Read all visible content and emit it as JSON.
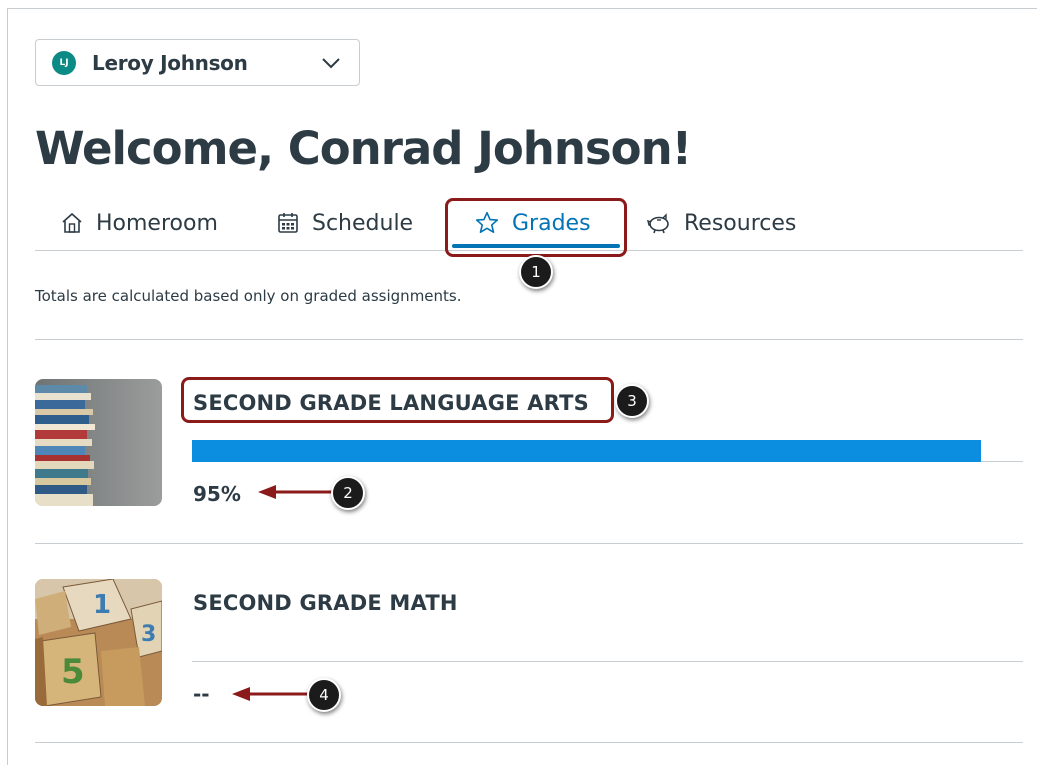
{
  "student_selector": {
    "initials": "LJ",
    "name": "Leroy Johnson"
  },
  "welcome_title": "Welcome, Conrad Johnson!",
  "tabs": [
    {
      "label": "Homeroom",
      "icon": "home-icon"
    },
    {
      "label": "Schedule",
      "icon": "calendar-icon"
    },
    {
      "label": "Grades",
      "icon": "star-icon",
      "active": true
    },
    {
      "label": "Resources",
      "icon": "piggy-bank-icon"
    }
  ],
  "note": "Totals are calculated based only on graded assignments.",
  "courses": [
    {
      "title": "SECOND GRADE LANGUAGE ARTS",
      "grade": "95%",
      "progress": 0.95,
      "image": "books-image"
    },
    {
      "title": "SECOND GRADE MATH",
      "grade": "--",
      "progress": 0,
      "image": "blocks-image"
    }
  ],
  "callouts": [
    "1",
    "2",
    "3",
    "4"
  ],
  "colors": {
    "accent": "#0374b5",
    "bar": "#0b8de0",
    "annotation": "#8b1a1a",
    "text": "#2d3b45"
  }
}
